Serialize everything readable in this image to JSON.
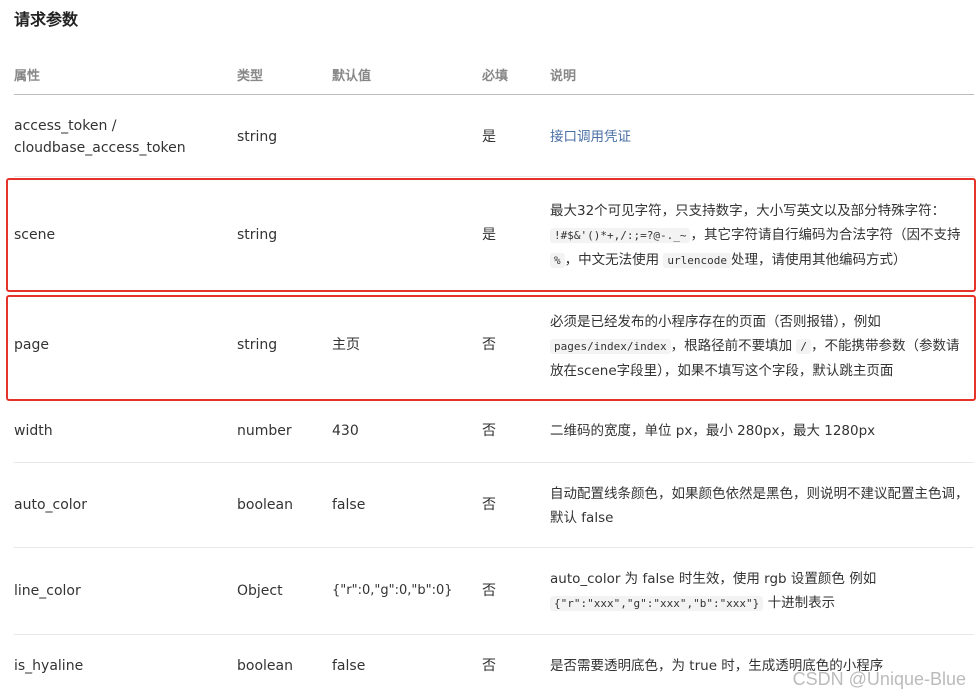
{
  "title": "请求参数",
  "headers": {
    "name": "属性",
    "type": "类型",
    "default": "默认值",
    "required": "必填",
    "desc": "说明"
  },
  "rows": [
    {
      "name1": "access_token /",
      "name2": "cloudbase_access_token",
      "type": "string",
      "default": "",
      "required": "是",
      "desc": "接口调用凭证"
    },
    {
      "name": "scene",
      "type": "string",
      "default": "",
      "required": "是",
      "desc_l1": "最大32个可见字符，只支持数字，大小写英文以及部分特殊字符：",
      "desc_code1": "!#$&'()*+,/:;=?@-._~",
      "desc_l2": "，其它字符请自行编码为合法字符（因不支持",
      "desc_code2": "%",
      "desc_l3": "，中文无法使用",
      "desc_code3": "urlencode",
      "desc_l4": "处理，请使用其他编码方式）"
    },
    {
      "name": "page",
      "type": "string",
      "default": "主页",
      "required": "否",
      "desc_l1": "必须是已经发布的小程序存在的页面（否则报错），例如",
      "desc_code1": "pages/index/index",
      "desc_l2": "，根路径前不要填加",
      "desc_code2": "/",
      "desc_l3": "，不能携带参数（参数请放在scene字段里），如果不填写这个字段，默认跳主页面"
    },
    {
      "name": "width",
      "type": "number",
      "default": "430",
      "required": "否",
      "desc": "二维码的宽度，单位 px，最小 280px，最大 1280px"
    },
    {
      "name": "auto_color",
      "type": "boolean",
      "default": "false",
      "required": "否",
      "desc": "自动配置线条颜色，如果颜色依然是黑色，则说明不建议配置主色调，默认 false"
    },
    {
      "name": "line_color",
      "type": "Object",
      "default": "{\"r\":0,\"g\":0,\"b\":0}",
      "required": "否",
      "desc_l1": "auto_color 为 false 时生效，使用 rgb 设置颜色 例如",
      "desc_code1": "{\"r\":\"xxx\",\"g\":\"xxx\",\"b\":\"xxx\"}",
      "desc_l2": "十进制表示"
    },
    {
      "name": "is_hyaline",
      "type": "boolean",
      "default": "false",
      "required": "否",
      "desc": "是否需要透明底色，为 true 时，生成透明底色的小程序"
    }
  ],
  "watermark": "CSDN @Unique-Blue",
  "colors": {
    "highlight": "#e5332a",
    "link": "#4a6fa5"
  }
}
